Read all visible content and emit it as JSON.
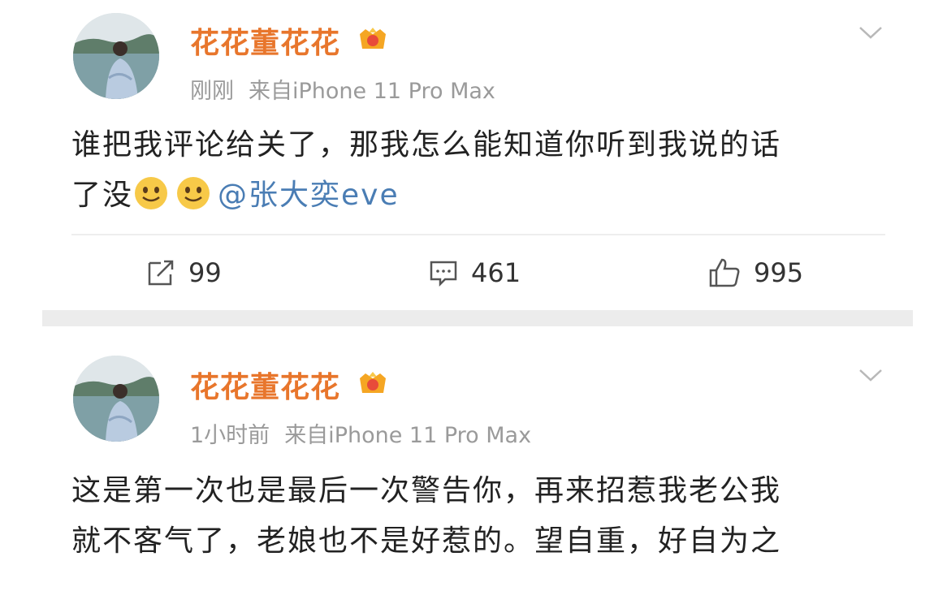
{
  "posts": [
    {
      "username": "花花董花花",
      "time": "刚刚",
      "source": "来自iPhone 11 Pro Max",
      "content_line1": "谁把我评论给关了，那我怎么能知道你听到我说的话",
      "content_line2_prefix": "了没",
      "emojis": [
        "smile-emoji",
        "smile-emoji"
      ],
      "mention": "@张大奕eve",
      "actions": {
        "repost_count": "99",
        "comment_count": "461",
        "like_count": "995"
      }
    },
    {
      "username": "花花董花花",
      "time": "1小时前",
      "source": "来自iPhone 11 Pro Max",
      "content_line1": "这是第一次也是最后一次警告你，再来招惹我老公我",
      "content_line2": "就不客气了，老娘也不是好惹的。望自重，好自为之"
    }
  ],
  "colors": {
    "username": "#e8762c",
    "meta": "#9a9a9a",
    "mention": "#4a7db4",
    "separator": "#ececec"
  },
  "icons": [
    "vip-crown-badge",
    "chevron-down-icon",
    "repost-icon",
    "comment-icon",
    "like-icon",
    "smile-emoji"
  ]
}
